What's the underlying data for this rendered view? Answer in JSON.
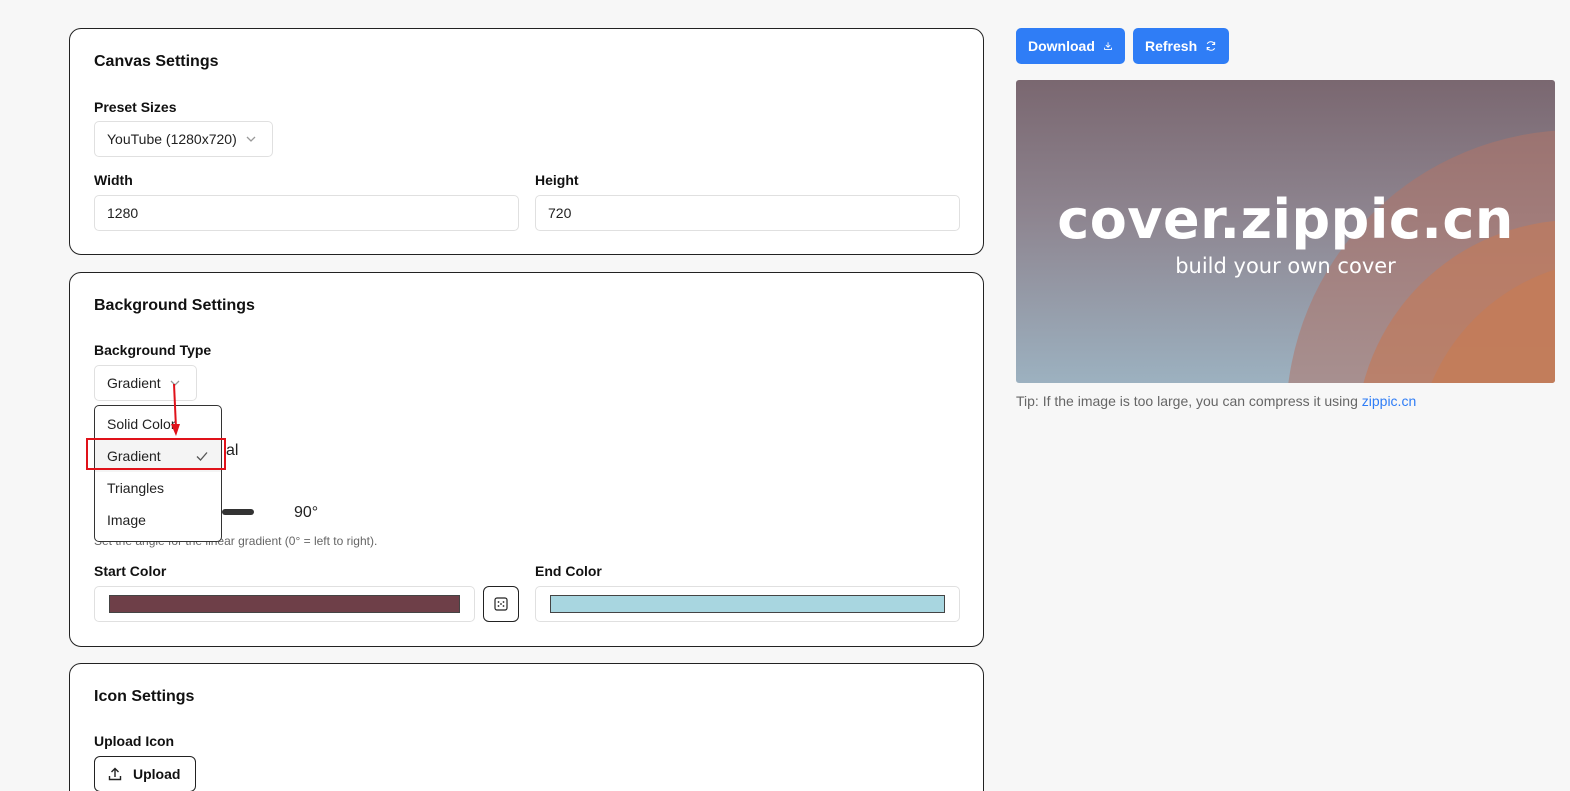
{
  "canvas": {
    "title": "Canvas Settings",
    "preset_label": "Preset Sizes",
    "preset_value": "YouTube (1280x720)",
    "width_label": "Width",
    "width_value": "1280",
    "height_label": "Height",
    "height_value": "720"
  },
  "background": {
    "title": "Background Settings",
    "type_label": "Background Type",
    "type_value": "Gradient",
    "options": [
      "Solid Color",
      "Gradient",
      "Triangles",
      "Image"
    ],
    "selected_option": "Gradient",
    "obscured_text": "al",
    "angle_value": "90°",
    "angle_hint": "Set the angle for the linear gradient (0° = left to right).",
    "start_label": "Start Color",
    "start_color": "#6e3f48",
    "end_label": "End Color",
    "end_color": "#a8d6e0"
  },
  "icon": {
    "title": "Icon Settings",
    "upload_label": "Upload Icon",
    "upload_button": "Upload"
  },
  "actions": {
    "download": "Download",
    "refresh": "Refresh"
  },
  "preview": {
    "title": "cover.zippic.cn",
    "subtitle": "build your own cover"
  },
  "tip": {
    "text": "Tip: If the image is too large, you can compress it using ",
    "link": "zippic.cn"
  },
  "colors": {
    "accent": "#2f7df6",
    "highlight": "#e0121a"
  }
}
